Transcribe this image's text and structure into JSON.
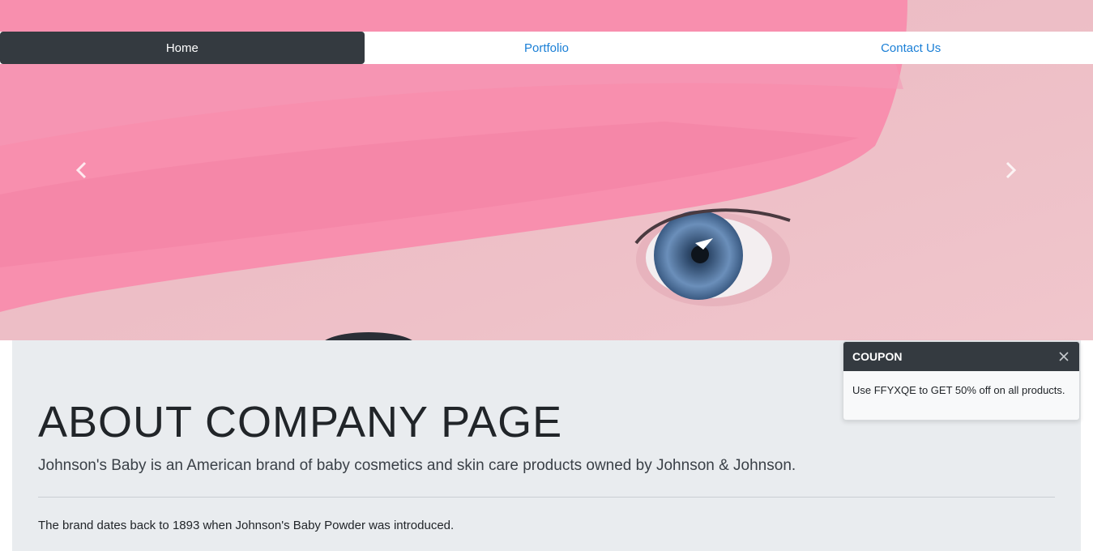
{
  "nav": {
    "items": [
      {
        "label": "Home"
      },
      {
        "label": "Portfolio"
      },
      {
        "label": "Contact Us"
      }
    ],
    "active": "Home"
  },
  "carousel": {
    "prev_icon": "chevron-left-icon",
    "next_icon": "chevron-right-icon",
    "image_subject": "baby-eye-photo"
  },
  "jumbotron": {
    "title": "ABOUT COMPANY PAGE",
    "lead": "Johnson's Baby is an American brand of baby cosmetics and skin care products owned by Johnson & Johnson.",
    "body": "The brand dates back to 1893 when Johnson's Baby Powder was introduced."
  },
  "toast": {
    "title": "COUPON",
    "message": "Use FFYXQE to GET 50% off on all products.",
    "close_icon": "close-icon"
  },
  "colors": {
    "nav_active_bg": "#343a40",
    "link": "#1a7fd6",
    "jumbotron_bg": "#e9ecef"
  }
}
